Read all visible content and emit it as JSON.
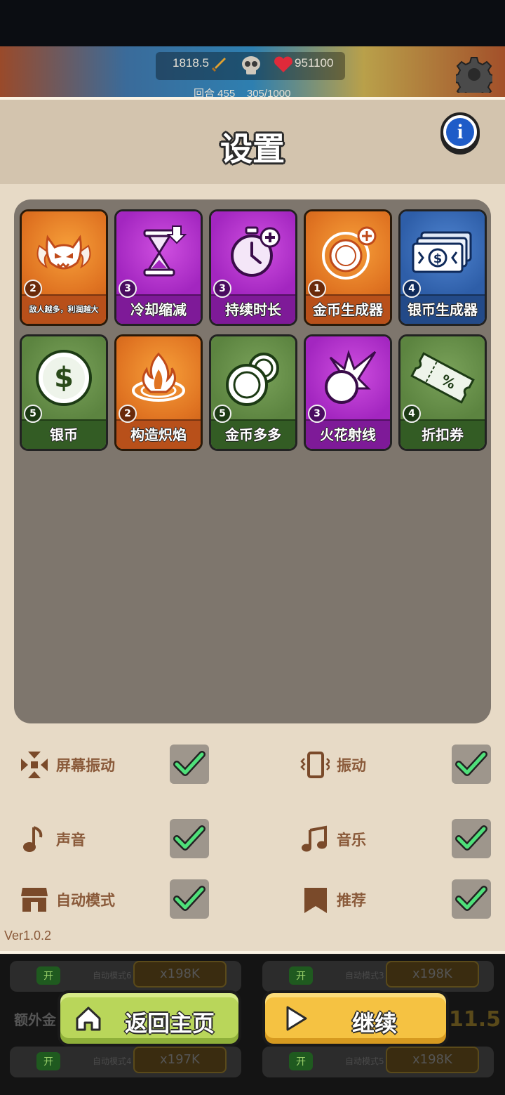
{
  "hud": {
    "attack": "1818.5",
    "kills_icon": "skull-icon",
    "health": "951100",
    "round_label": "回合 455",
    "round_progress": "305/1000"
  },
  "settings": {
    "title": "设置",
    "info_glyph": "i",
    "cards": [
      {
        "label": "敌人越多，利润越大",
        "level": "2",
        "color": "orange",
        "icon": "demon-icon"
      },
      {
        "label": "冷却缩减",
        "level": "3",
        "color": "purple",
        "icon": "hourglass-icon"
      },
      {
        "label": "持续时长",
        "level": "3",
        "color": "purple",
        "icon": "stopwatch-plus-icon"
      },
      {
        "label": "金币生成器",
        "level": "1",
        "color": "orange",
        "icon": "coin-generator-icon"
      },
      {
        "label": "银币生成器",
        "level": "4",
        "color": "blue",
        "icon": "banknotes-icon"
      },
      {
        "label": "银币",
        "level": "5",
        "color": "green",
        "icon": "dollar-coin-icon"
      },
      {
        "label": "构造炽焰",
        "level": "2",
        "color": "orange",
        "icon": "flame-icon"
      },
      {
        "label": "金币多多",
        "level": "5",
        "color": "green",
        "icon": "coins-icon"
      },
      {
        "label": "火花射线",
        "level": "3",
        "color": "purple",
        "icon": "spark-burst-icon"
      },
      {
        "label": "折扣券",
        "level": "4",
        "color": "green",
        "icon": "discount-ticket-icon"
      }
    ],
    "toggles": {
      "screen_shake": {
        "label": "屏幕振动",
        "checked": true
      },
      "vibration": {
        "label": "振动",
        "checked": true
      },
      "sound": {
        "label": "声音",
        "checked": true
      },
      "music": {
        "label": "音乐",
        "checked": true
      },
      "auto_mode": {
        "label": "自动模式",
        "checked": true
      },
      "recommend": {
        "label": "推荐",
        "checked": true
      }
    },
    "version": "Ver1.0.2"
  },
  "buttons": {
    "home_label": "返回主页",
    "continue_label": "继续"
  },
  "background": {
    "left_top_tag": "开",
    "left_top_mode": "自动模式6",
    "left_top_price": "x198K",
    "right_top_tag": "开",
    "right_top_mode": "自动模式3",
    "right_top_price": "x198K",
    "left_label": "额外金",
    "left_bottom_tag": "开",
    "left_bottom_mode": "自动模式4",
    "left_bottom_price": "x197K",
    "right_bottom_tag": "开",
    "right_bottom_mode": "自动模式5",
    "right_bottom_price": "x198K",
    "right_value": "11.5"
  },
  "colors": {
    "panel_bg": "#e7dac6",
    "grid_bg": "#7e766d",
    "check_green": "#4fe07a",
    "label_brown": "#8a5a3a"
  }
}
